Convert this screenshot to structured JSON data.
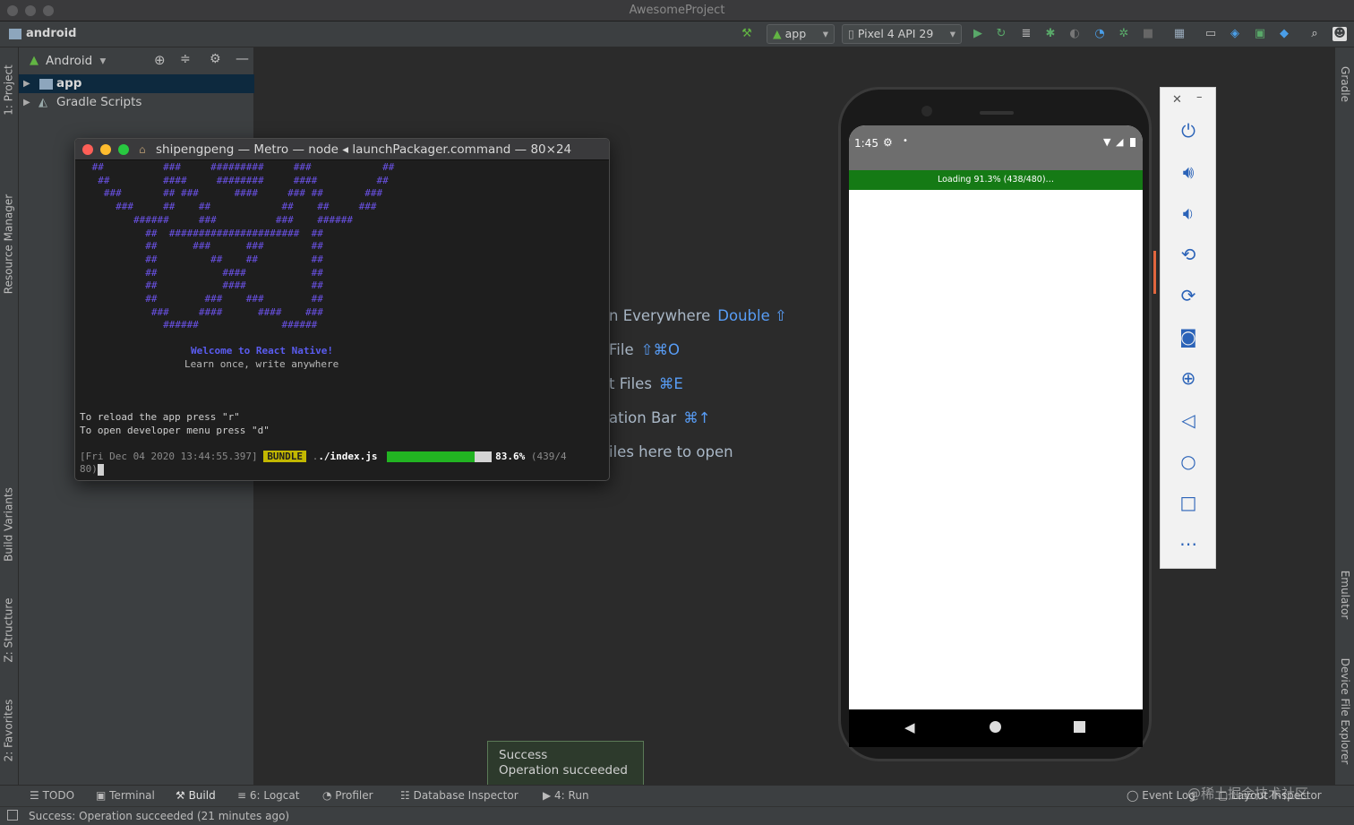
{
  "window": {
    "title": "AwesomeProject"
  },
  "toolbar": {
    "project": "android",
    "run_config": "app",
    "device": "Pixel 4 API 29"
  },
  "left_tabs": [
    "1: Project",
    "Resource Manager",
    "Build Variants",
    "Z: Structure",
    "2: Favorites"
  ],
  "right_tabs": [
    "Gradle",
    "Emulator",
    "Device File Explorer"
  ],
  "project_panel": {
    "view_mode": "Android",
    "tree": [
      {
        "label": "app",
        "selected": true
      },
      {
        "label": "Gradle Scripts",
        "selected": false
      }
    ]
  },
  "editor_hints": [
    {
      "text": "n Everywhere",
      "key": "Double ⇧"
    },
    {
      "text": "File",
      "key": "⇧⌘O"
    },
    {
      "text": "t Files",
      "key": "⌘E"
    },
    {
      "text": "ation Bar",
      "key": "⌘↑"
    },
    {
      "text": "iles here to open",
      "key": ""
    }
  ],
  "terminal": {
    "title": "shipengpeng — Metro — node ◂ launchPackager.command — 80×24",
    "art": " ##          ###     #########     ###            ##\n  ##         ####     ########     ####          ##\n   ###       ## ###      ####     ### ##       ###\n     ###     ##    ##            ##    ##     ###\n        ######     ###          ###    ######\n          ##  ######################  ##\n          ##      ###      ###        ##\n          ##         ##    ##         ##\n          ##           ####           ##\n          ##           ####           ##\n          ##        ###    ###        ##\n           ###     ####      ####    ###\n             ######              ######",
    "welcome": "Welcome to React Native!",
    "tagline": "Learn once, write anywhere",
    "reload_hint": "To reload the app press \"r\"",
    "menu_hint": "To open developer menu press \"d\"",
    "log_time": "[Fri Dec 04 2020 13:44:55.397]",
    "badge": "BUNDLE",
    "file": "./index.js",
    "progress": 0.836,
    "percent": "83.6%",
    "count_a": "(439/4",
    "count_b": "80)"
  },
  "phone": {
    "time": "1:45",
    "loading_text": "Loading 91.3% (438/480)…"
  },
  "emulator_controls": [
    "power-icon",
    "volume-up-icon",
    "volume-down-icon",
    "rotate-left-icon",
    "rotate-right-icon",
    "camera-icon",
    "zoom-icon",
    "back-icon",
    "home-icon",
    "overview-icon",
    "more-icon"
  ],
  "toast": {
    "title": "Success",
    "message": "Operation succeeded"
  },
  "bottom_tabs": [
    "TODO",
    "Terminal",
    "Build",
    "6: Logcat",
    "Profiler",
    "Database Inspector",
    "4: Run",
    "Event Log",
    "Layout Inspector"
  ],
  "status": "Success: Operation succeeded (21 minutes ago)",
  "watermark": "@稀土掘金技术社区"
}
